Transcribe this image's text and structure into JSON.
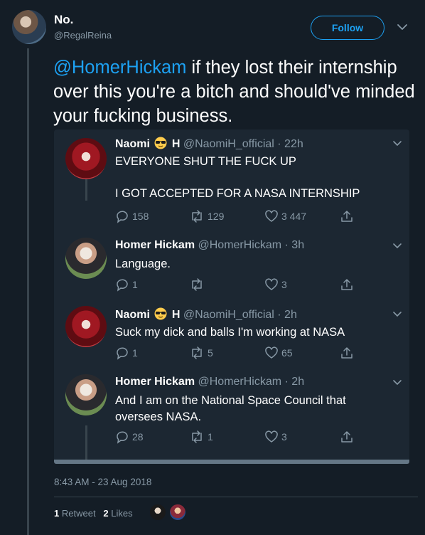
{
  "author": {
    "name": "No.",
    "handle": "@RegalReina",
    "follow_label": "Follow"
  },
  "tweet": {
    "mention": "@HomerHickam",
    "text": " if they lost their internship over this you're a bitch and should've minded your fucking business.",
    "timestamp": "8:43 AM - 23 Aug 2018",
    "retweets": "1",
    "retweets_label": "Retweet",
    "likes": "2",
    "likes_label": "Likes"
  },
  "quoted_thread": [
    {
      "name_first": "Naomi",
      "name_last": "H",
      "emoji": "sunglasses-emoji",
      "meta": "@NaomiH_official · 22h",
      "line1": "EVERYONE SHUT THE FUCK UP",
      "line2": "I GOT ACCEPTED FOR A NASA INTERNSHIP",
      "replies": "158",
      "retweets": "129",
      "likes": "3 447"
    },
    {
      "name_first": "Homer Hickam",
      "meta": "@HomerHickam · 3h",
      "line1": "Language.",
      "replies": "1",
      "retweets": "",
      "likes": "3"
    },
    {
      "name_first": "Naomi",
      "name_last": "H",
      "emoji": "sunglasses-emoji",
      "meta": "@NaomiH_official · 2h",
      "line1": "Suck my dick and balls I'm working at NASA",
      "replies": "1",
      "retweets": "5",
      "likes": "65"
    },
    {
      "name_first": "Homer Hickam",
      "meta": "@HomerHickam · 2h",
      "line1": "And I am on the National Space Council that oversees NASA.",
      "replies": "28",
      "retweets": "1",
      "likes": "3"
    }
  ],
  "colors": {
    "background": "#141d26",
    "card": "#1c2732",
    "accent": "#1da1f2",
    "muted": "#8899a6"
  }
}
